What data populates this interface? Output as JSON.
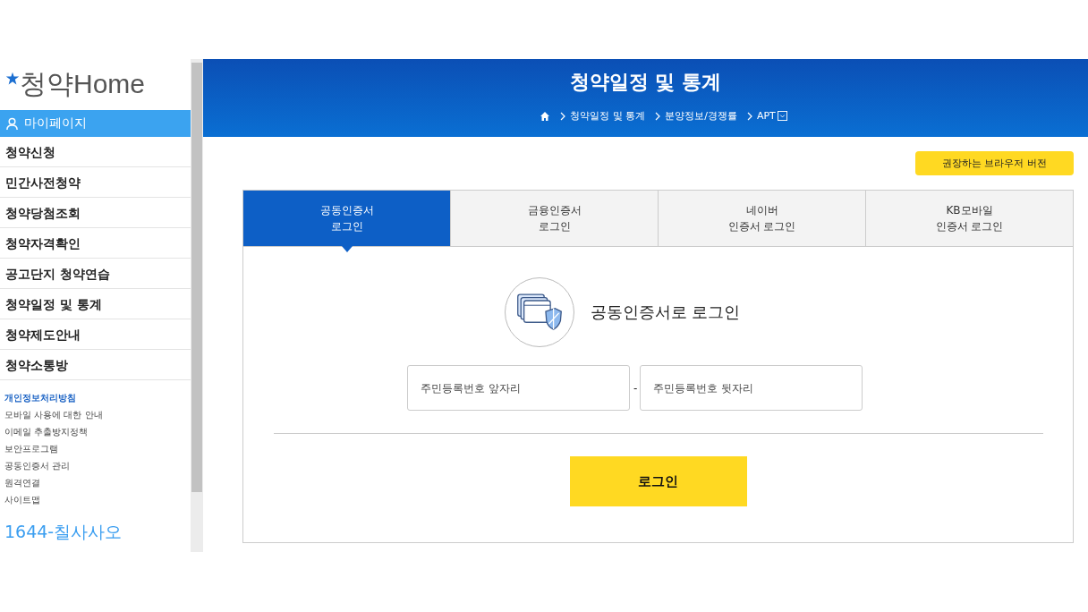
{
  "logo": {
    "text": "청약Home"
  },
  "sidebar": {
    "mypage": "마이페이지",
    "menu": [
      "청약신청",
      "민간사전청약",
      "청약당첨조회",
      "청약자격확인",
      "공고단지 청약연습",
      "청약일정 및 통계",
      "청약제도안내",
      "청약소통방"
    ],
    "links": [
      {
        "label": "개인정보처리방침",
        "highlighted": true
      },
      {
        "label": "모바일 사용에 대한 안내",
        "highlighted": false
      },
      {
        "label": "이메일 추출방지정책",
        "highlighted": false
      },
      {
        "label": "보안프로그램",
        "highlighted": false
      },
      {
        "label": "공동인증서 관리",
        "highlighted": false
      },
      {
        "label": "원격연결",
        "highlighted": false
      },
      {
        "label": "사이트맵",
        "highlighted": false
      }
    ],
    "phone": "1644-칠사사오"
  },
  "header": {
    "title": "청약일정 및 통계",
    "breadcrumb": [
      "청약일정 및 통계",
      "분양정보/경쟁률",
      "APT"
    ]
  },
  "browser_button": "권장하는 브라우저 버전",
  "tabs": [
    {
      "lines": [
        "공동인증서",
        "로그인"
      ],
      "selected": true
    },
    {
      "lines": [
        "금융인증서",
        "로그인"
      ],
      "selected": false
    },
    {
      "lines": [
        "네이버",
        "인증서 로그인"
      ],
      "selected": false
    },
    {
      "lines": [
        "KB모바일",
        "인증서 로그인"
      ],
      "selected": false
    }
  ],
  "login": {
    "title": "공동인증서로 로그인",
    "front_placeholder": "주민등록번호 앞자리",
    "separator": "-",
    "back_placeholder": "주민등록번호 뒷자리",
    "button": "로그인"
  }
}
